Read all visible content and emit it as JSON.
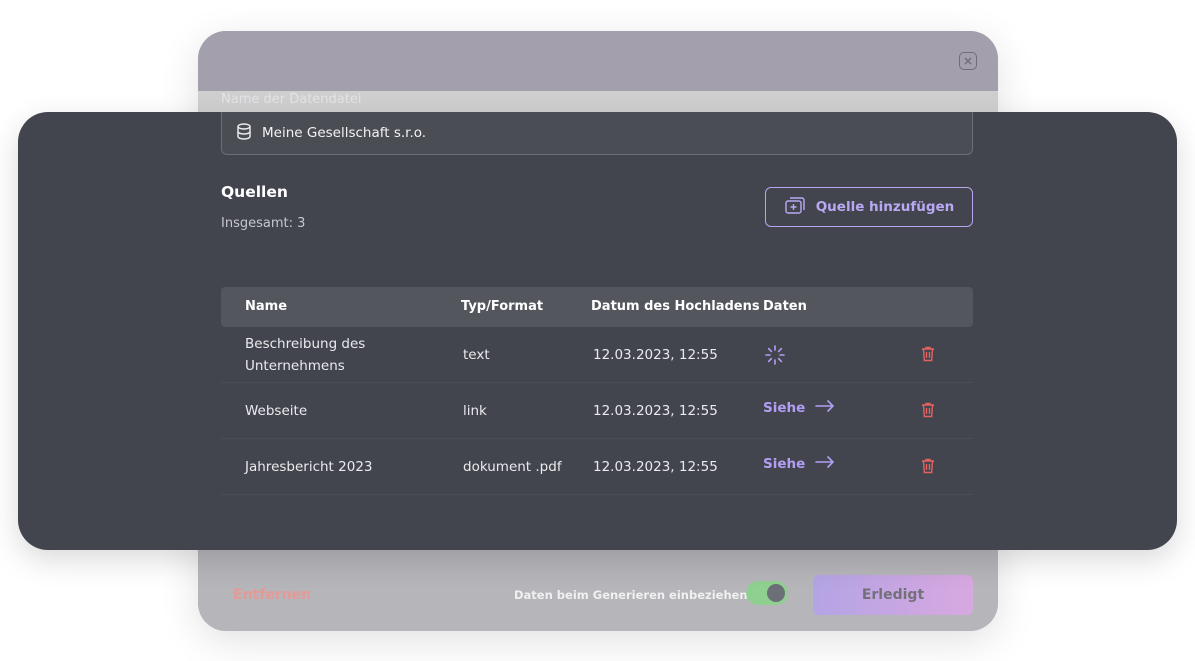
{
  "dialog": {
    "field_label": "Name der Datendatei",
    "datafile_name": "Meine Gesellschaft s.r.o."
  },
  "sources": {
    "title": "Quellen",
    "total_text": "Insgesamt: 3",
    "add_button_label": "Quelle hinzufügen",
    "columns": [
      "Name",
      "Typ/Format",
      "Datum des Hochladens",
      "Daten"
    ],
    "rows": [
      {
        "name_line1": "Beschreibung des",
        "name_line2": "Unternehmens",
        "type": "text",
        "date": "12.03.2023, 12:55",
        "data_status": "loading"
      },
      {
        "name_line1": "Webseite",
        "type": "link",
        "date": "12.03.2023, 12:55",
        "data_link": "Siehe"
      },
      {
        "name_line1": "Jahresbericht 2023",
        "type": "dokument .pdf",
        "date": "12.03.2023, 12:55",
        "data_link": "Siehe"
      }
    ]
  },
  "footer": {
    "remove_label": "Entfernen",
    "include_label": "Daten beim Generieren einbeziehen",
    "include_toggle_on": true,
    "done_label": "Erledigt"
  },
  "icons": {
    "close": "close-icon",
    "database": "database-icon",
    "add_folder": "add-folder-icon",
    "spinner": "loading-spinner-icon",
    "arrow": "arrow-right-icon",
    "trash": "trash-icon"
  },
  "colors": {
    "accent": "#b39ef5",
    "danger": "#e2635d",
    "overlay": "#43454e"
  }
}
